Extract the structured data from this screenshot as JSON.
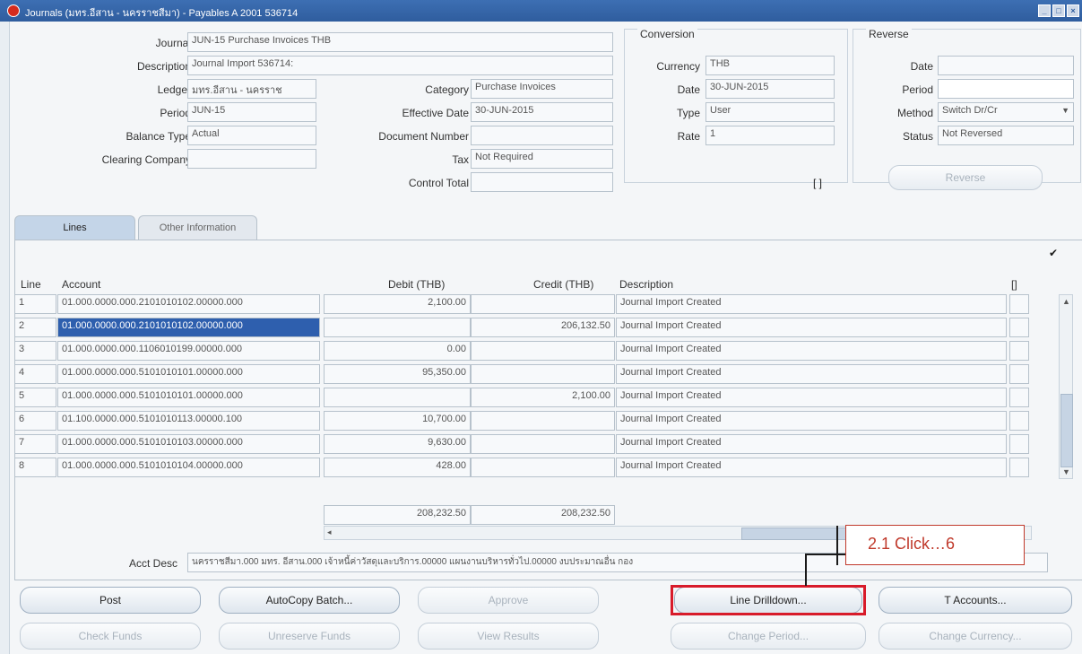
{
  "window": {
    "title": "Journals (มทร.อีสาน - นครราชสีมา) - Payables A 2001 536714",
    "controls": [
      "minimize",
      "maximize",
      "close"
    ]
  },
  "header": {
    "journal_label": "Journal",
    "journal_value": "JUN-15 Purchase Invoices THB",
    "description_label": "Description",
    "description_value": "Journal Import 536714:",
    "ledger_label": "Ledger",
    "ledger_value": "มทร.อีสาน - นครราช",
    "period_label": "Period",
    "period_value": "JUN-15",
    "balance_type_label": "Balance Type",
    "balance_type_value": "Actual",
    "clearing_company_label": "Clearing Company",
    "clearing_company_value": "",
    "category_label": "Category",
    "category_value": "Purchase Invoices",
    "effective_date_label": "Effective Date",
    "effective_date_value": "30-JUN-2015",
    "document_number_label": "Document Number",
    "document_number_value": "",
    "tax_label": "Tax",
    "tax_value": "Not Required",
    "control_total_label": "Control Total",
    "control_total_value": ""
  },
  "conversion": {
    "title": "Conversion",
    "currency_label": "Currency",
    "currency_value": "THB",
    "date_label": "Date",
    "date_value": "30-JUN-2015",
    "type_label": "Type",
    "type_value": "User",
    "rate_label": "Rate",
    "rate_value": "1",
    "bracket": "[ ]"
  },
  "reverse": {
    "title": "Reverse",
    "date_label": "Date",
    "date_value": "",
    "period_label": "Period",
    "period_value": "",
    "method_label": "Method",
    "method_value": "Switch Dr/Cr",
    "status_label": "Status",
    "status_value": "Not Reversed",
    "reverse_button": "Reverse"
  },
  "tabs": {
    "lines": "Lines",
    "other": "Other Information"
  },
  "lines": {
    "columns": {
      "line": "Line",
      "account": "Account",
      "debit": "Debit (THB)",
      "credit": "Credit (THB)",
      "description": "Description",
      "flex": "[]"
    },
    "rows": [
      {
        "line": "1",
        "account": "01.000.0000.000.2101010102.00000.000",
        "debit": "2,100.00",
        "credit": "",
        "description": "Journal Import Created"
      },
      {
        "line": "2",
        "account": "01.000.0000.000.2101010102.00000.000",
        "debit": "",
        "credit": "206,132.50",
        "description": "Journal Import Created"
      },
      {
        "line": "3",
        "account": "01.000.0000.000.1106010199.00000.000",
        "debit": "0.00",
        "credit": "",
        "description": "Journal Import Created"
      },
      {
        "line": "4",
        "account": "01.000.0000.000.5101010101.00000.000",
        "debit": "95,350.00",
        "credit": "",
        "description": "Journal Import Created"
      },
      {
        "line": "5",
        "account": "01.000.0000.000.5101010101.00000.000",
        "debit": "",
        "credit": "2,100.00",
        "description": "Journal Import Created"
      },
      {
        "line": "6",
        "account": "01.100.0000.000.5101010113.00000.100",
        "debit": "10,700.00",
        "credit": "",
        "description": "Journal Import Created"
      },
      {
        "line": "7",
        "account": "01.000.0000.000.5101010103.00000.000",
        "debit": "9,630.00",
        "credit": "",
        "description": "Journal Import Created"
      },
      {
        "line": "8",
        "account": "01.000.0000.000.5101010104.00000.000",
        "debit": "428.00",
        "credit": "",
        "description": "Journal Import Created"
      }
    ],
    "total_debit": "208,232.50",
    "total_credit": "208,232.50"
  },
  "acct_desc": {
    "label": "Acct Desc",
    "value": "นครราชสีมา.000 มทร. อีสาน.000 เจ้าหนี้ค่าวัสดุและบริการ.00000 แผนงานบริหารทั่วไป.00000 งบประมาณอื่น กอง"
  },
  "buttons": {
    "post": "Post",
    "autocopy": "AutoCopy Batch...",
    "approve": "Approve",
    "line_drilldown": "Line Drilldown...",
    "t_accounts": "T Accounts...",
    "check_funds": "Check Funds",
    "unreserve": "Unreserve Funds",
    "view_results": "View Results",
    "change_period": "Change Period...",
    "change_currency": "Change Currency..."
  },
  "annotation": {
    "text": "2.1 Click…6"
  },
  "colors": {
    "titlebar": "#2f5d9e",
    "selected_row": "#2e5fae",
    "callout": "#c0392b",
    "highlight": "#d81b2a"
  }
}
